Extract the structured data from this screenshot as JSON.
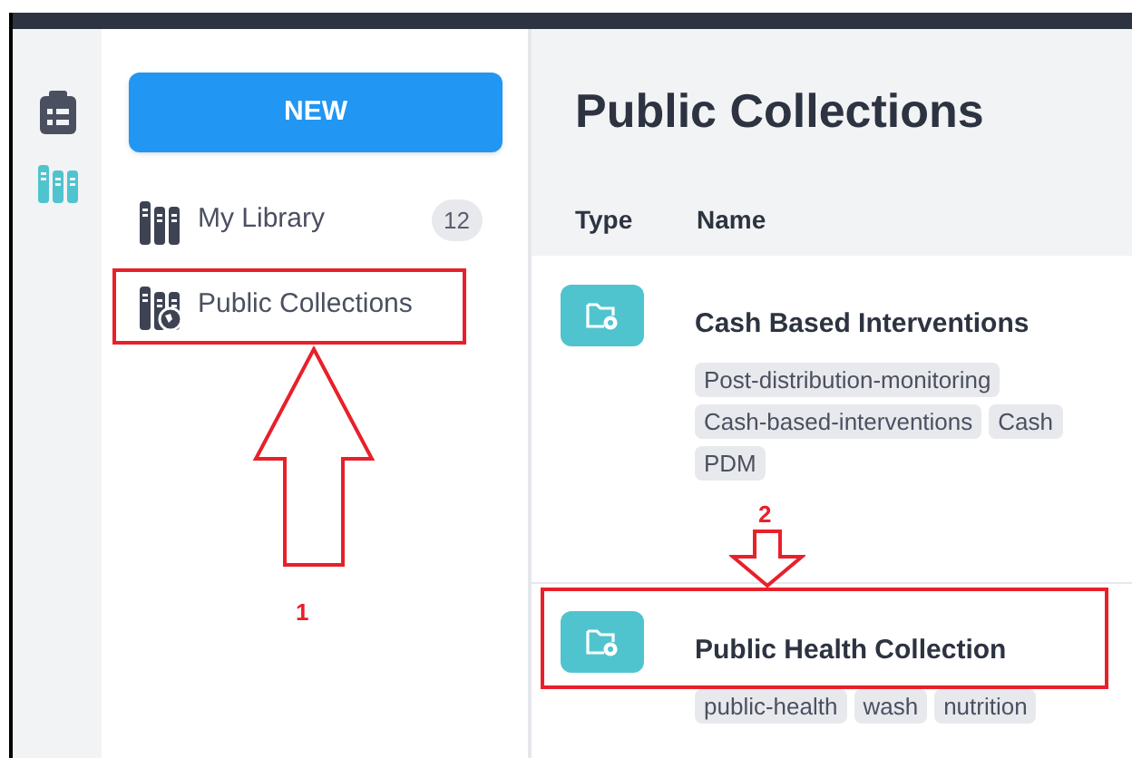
{
  "rail": [
    {
      "kind": "clipboard",
      "selected": false
    },
    {
      "kind": "books",
      "selected": true
    }
  ],
  "sidebar": {
    "new_button": "NEW",
    "items": [
      {
        "kind": "library",
        "label": "My Library",
        "count": "12"
      },
      {
        "kind": "public",
        "label": "Public Collections"
      }
    ]
  },
  "page_title": "Public Collections",
  "table": {
    "columns": [
      "Type",
      "Name"
    ],
    "rows": [
      {
        "name": "Cash Based Interventions",
        "tags": [
          "Post-distribution-monitoring",
          "Cash-based-interventions",
          "Cash",
          "PDM"
        ]
      },
      {
        "name": "Public Health Collection",
        "tags": [
          "public-health",
          "wash",
          "nutrition"
        ]
      }
    ]
  },
  "annotations": [
    {
      "label": "1"
    },
    {
      "label": "2"
    }
  ]
}
